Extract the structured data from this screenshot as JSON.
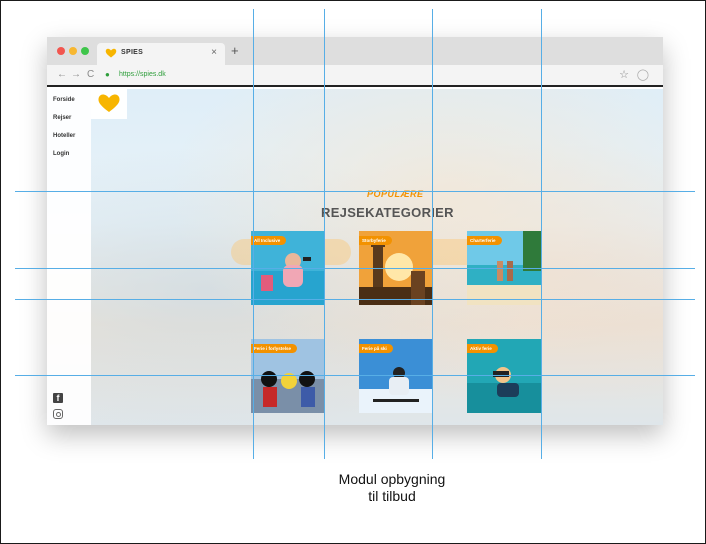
{
  "browser": {
    "tab_title": "SPIES",
    "tab_close": "×",
    "new_tab": "+",
    "url": "https://spies.dk",
    "nav": {
      "back": "←",
      "forward": "→",
      "reload": "C"
    },
    "icons": [
      "spies-logo-icon",
      "lock-icon",
      "star-icon",
      "user-icon"
    ]
  },
  "sidebar": {
    "items": [
      {
        "label": "Forside"
      },
      {
        "label": "Rejser"
      },
      {
        "label": "Hoteller"
      },
      {
        "label": "Login"
      }
    ],
    "social_icons": [
      "facebook-icon",
      "instagram-icon"
    ]
  },
  "section": {
    "subtitle": "POPULÆRE",
    "heading": "REJSEKATEGORIER"
  },
  "cards": [
    {
      "label": "All Inclusive",
      "scene": "pool"
    },
    {
      "label": "Storbyferie",
      "scene": "city"
    },
    {
      "label": "Charterferie",
      "scene": "beach"
    },
    {
      "label": "Ferie i forlystelse",
      "scene": "themepark"
    },
    {
      "label": "Ferie på ski",
      "scene": "ski"
    },
    {
      "label": "Aktiv ferie",
      "scene": "dive"
    }
  ],
  "caption": {
    "line1": "Modul opbygning",
    "line2": "til tilbud"
  },
  "colors": {
    "accent": "#f39200",
    "grid_lines": "#57aee6",
    "heading": "#555555",
    "url": "#2e9e3b"
  }
}
